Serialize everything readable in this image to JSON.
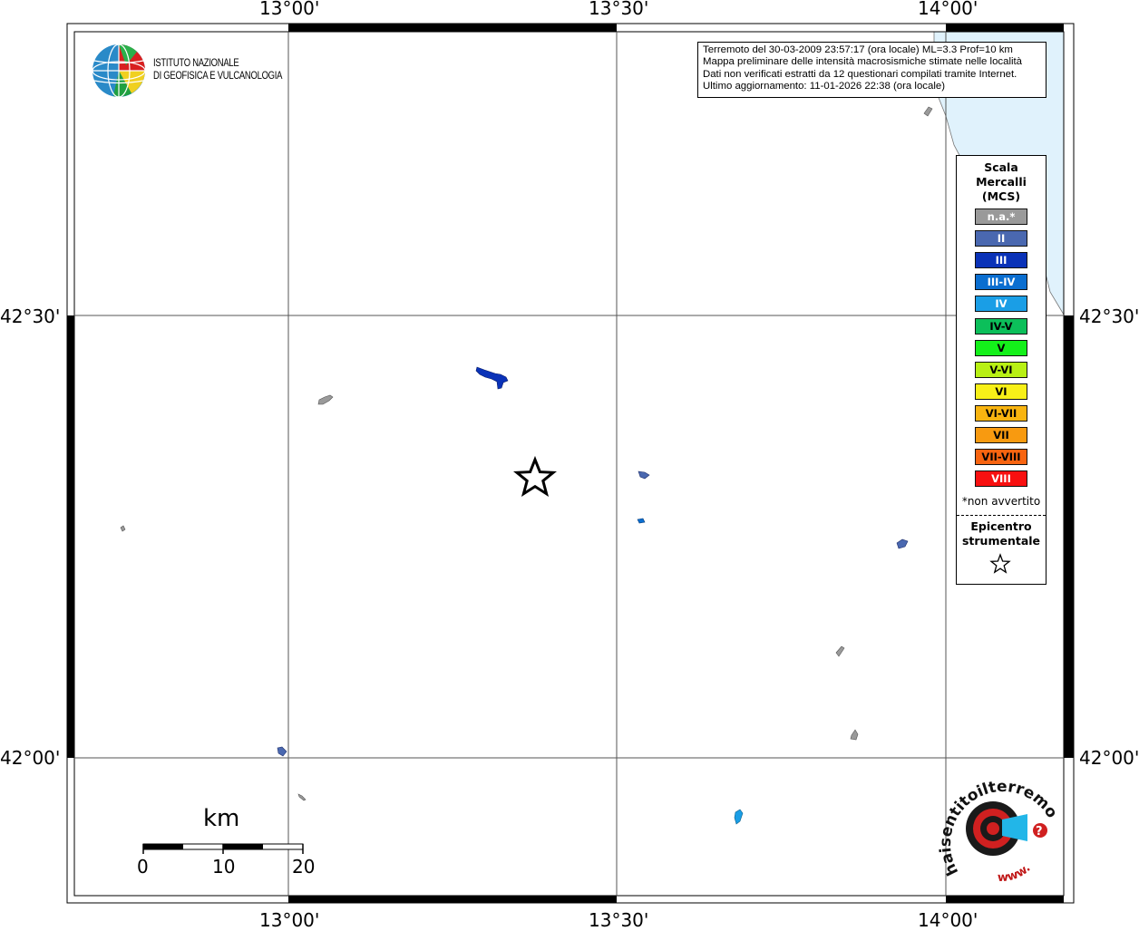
{
  "map": {
    "longitude_labels": [
      "13°00'",
      "13°30'",
      "14°00'"
    ],
    "latitude_labels": [
      "42°30'",
      "42°00'"
    ],
    "sea_color": "#e0f2fc",
    "epicenter_marker": "star-icon"
  },
  "header": {
    "org_line1": "ISTITUTO NAZIONALE",
    "org_line2": "DI GEOFISICA E VULCANOLOGIA"
  },
  "info": {
    "line1": "Terremoto del 30-03-2009 23:57:17 (ora locale) ML=3.3 Prof=10 km",
    "line2": "Mappa preliminare delle intensità macrosismiche stimate nelle località",
    "line3": "Dati non verificati estratti da 12 questionari compilati tramite Internet.",
    "line4": "Ultimo aggiornamento: 11-01-2026 22:38 (ora locale)"
  },
  "legend": {
    "title_line1": "Scala",
    "title_line2": "Mercalli",
    "title_line3": "(MCS)",
    "items": [
      {
        "label": "n.a.*",
        "color": "#9a9a9a",
        "text_color": "#ffffff"
      },
      {
        "label": "II",
        "color": "#4a68b0",
        "text_color": "#ffffff"
      },
      {
        "label": "III",
        "color": "#0a32b8",
        "text_color": "#ffffff"
      },
      {
        "label": "III-IV",
        "color": "#0a6ed0",
        "text_color": "#ffffff"
      },
      {
        "label": "IV",
        "color": "#1a9ee6",
        "text_color": "#ffffff"
      },
      {
        "label": "IV-V",
        "color": "#0cbf5a",
        "text_color": "#000000"
      },
      {
        "label": "V",
        "color": "#14f01a",
        "text_color": "#000000"
      },
      {
        "label": "V-VI",
        "color": "#b8f014",
        "text_color": "#000000"
      },
      {
        "label": "VI",
        "color": "#f8f018",
        "text_color": "#000000"
      },
      {
        "label": "VI-VII",
        "color": "#f8b410",
        "text_color": "#000000"
      },
      {
        "label": "VII",
        "color": "#f89a10",
        "text_color": "#000000"
      },
      {
        "label": "VII-VIII",
        "color": "#f86410",
        "text_color": "#000000"
      },
      {
        "label": "VIII",
        "color": "#f81010",
        "text_color": "#ffffff"
      }
    ],
    "note": "*non avvertito",
    "epicenter_line1": "Epicentro",
    "epicenter_line2": "strumentale"
  },
  "scale_bar": {
    "title": "km",
    "ticks": [
      "0",
      "10",
      "20"
    ]
  },
  "watermark": {
    "text": "haisentitoilterremoto.it",
    "url_text": "www.",
    "question": "?"
  },
  "localities": [
    {
      "intensity": "n.a.*",
      "color": "#9a9a9a"
    },
    {
      "intensity": "III",
      "color": "#0a32b8"
    },
    {
      "intensity": "n.a.*",
      "color": "#9a9a9a"
    },
    {
      "intensity": "II",
      "color": "#4a68b0"
    },
    {
      "intensity": "III-IV",
      "color": "#0a6ed0"
    },
    {
      "intensity": "II",
      "color": "#4a68b0"
    },
    {
      "intensity": "n.a.*",
      "color": "#9a9a9a"
    },
    {
      "intensity": "n.a.*",
      "color": "#9a9a9a"
    },
    {
      "intensity": "II",
      "color": "#4a68b0"
    },
    {
      "intensity": "n.a.*",
      "color": "#9a9a9a"
    },
    {
      "intensity": "IV",
      "color": "#1a9ee6"
    },
    {
      "intensity": "n.a.*",
      "color": "#9a9a9a"
    }
  ]
}
